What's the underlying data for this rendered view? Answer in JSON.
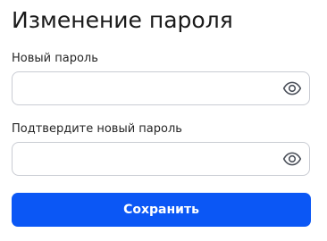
{
  "page": {
    "title": "Изменение пароля"
  },
  "fields": {
    "new_password": {
      "label": "Новый пароль",
      "value": "",
      "placeholder": "",
      "toggle_icon": "eye-icon"
    },
    "confirm_password": {
      "label": "Подтвердите новый пароль",
      "value": "",
      "placeholder": "",
      "toggle_icon": "eye-icon"
    }
  },
  "actions": {
    "save_label": "Сохранить"
  },
  "colors": {
    "accent": "#0b57f5",
    "input_border": "#c9ccd3",
    "icon": "#4a4f59"
  }
}
